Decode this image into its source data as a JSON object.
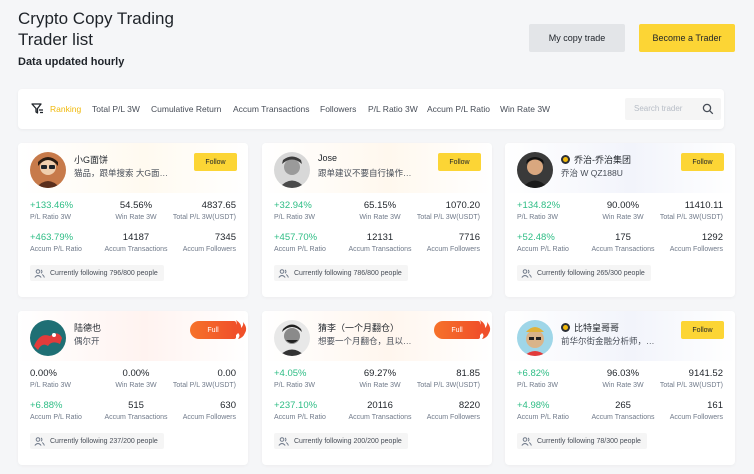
{
  "header": {
    "title_line1": "Crypto Copy Trading",
    "title_line2": "Trader list",
    "subtitle": "Data updated hourly",
    "my_copy_trade": "My copy trade",
    "become_trader": "Become a Trader"
  },
  "filters": {
    "tabs": [
      "Ranking",
      "Total P/L 3W",
      "Cumulative Return",
      "Accum Transactions",
      "Followers",
      "P/L Ratio 3W",
      "Accum P/L Ratio",
      "Win Rate 3W"
    ],
    "search_placeholder": "Search trader"
  },
  "labels": {
    "pl_ratio": "P/L Ratio 3W",
    "win_rate": "Win Rate 3W",
    "total_pl": "Total P/L 3W(USDT)",
    "accum_pl": "Accum P/L Ratio",
    "accum_tx": "Accum Transactions",
    "accum_followers": "Accum Followers",
    "follow": "Follow",
    "full": "Full"
  },
  "traders": [
    {
      "name": "小G面饼",
      "bio": "猫品，跟单搜索 大G面…",
      "badge": false,
      "action": "Follow",
      "pl_ratio": "+133.46%",
      "win_rate": "54.56%",
      "total_pl": "4837.65",
      "accum_pl": "+463.79%",
      "accum_tx": "14187",
      "accum_followers": "7345",
      "following": "Currently following 796/800 people"
    },
    {
      "name": "Jose",
      "bio": "跟单建议不要自行操作…",
      "badge": false,
      "action": "Follow",
      "pl_ratio": "+32.94%",
      "win_rate": "65.15%",
      "total_pl": "1070.20",
      "accum_pl": "+457.70%",
      "accum_tx": "12131",
      "accum_followers": "7716",
      "following": "Currently following 786/800 people"
    },
    {
      "name": "乔治-乔治集团",
      "bio": "乔治 W QZ188U",
      "badge": true,
      "action": "Follow",
      "pl_ratio": "+134.82%",
      "win_rate": "90.00%",
      "total_pl": "11410.11",
      "accum_pl": "+52.48%",
      "accum_tx": "175",
      "accum_followers": "1292",
      "following": "Currently following 265/300 people"
    },
    {
      "name": "陆德也",
      "bio": "偶尔开",
      "badge": false,
      "action": "Full",
      "pl_ratio": "0.00%",
      "win_rate": "0.00%",
      "total_pl": "0.00",
      "accum_pl": "+6.88%",
      "accum_tx": "515",
      "accum_followers": "630",
      "following": "Currently following 237/200 people"
    },
    {
      "name": "猜李（一个月翻仓）",
      "bio": "想要一个月翻仓，且以…",
      "badge": false,
      "action": "Full",
      "pl_ratio": "+4.05%",
      "win_rate": "69.27%",
      "total_pl": "81.85",
      "accum_pl": "+237.10%",
      "accum_tx": "20116",
      "accum_followers": "8220",
      "following": "Currently following 200/200 people"
    },
    {
      "name": "比特皇哥哥",
      "bio": "前华尔街金融分析师，…",
      "badge": true,
      "action": "Follow",
      "pl_ratio": "+6.82%",
      "win_rate": "96.03%",
      "total_pl": "9141.52",
      "accum_pl": "+4.98%",
      "accum_tx": "265",
      "accum_followers": "161",
      "following": "Currently following 78/300 people"
    }
  ]
}
